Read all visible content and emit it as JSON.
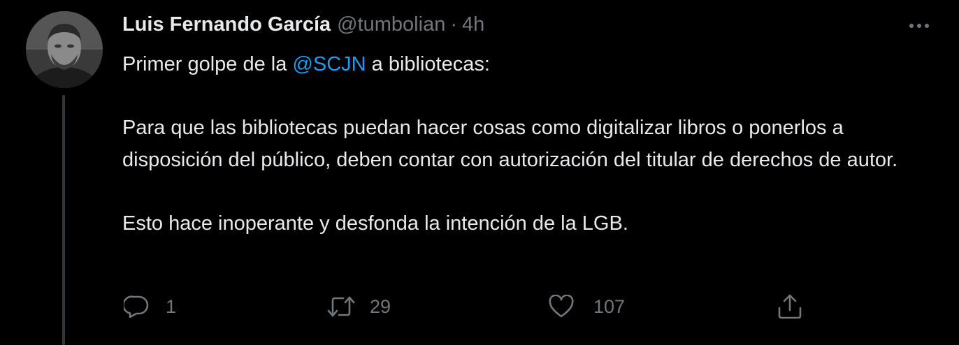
{
  "tweet": {
    "author": {
      "name": "Luis Fernando García",
      "handle": "@tumbolian",
      "separator": "·",
      "time": "4h",
      "avatar": "avatar-photo-grayscale"
    },
    "text": {
      "line1_prefix": "Primer golpe de la ",
      "line1_mention": "@SCJN",
      "line1_suffix": " a bibliotecas:",
      "paragraph2": "Para que las bibliotecas puedan hacer cosas como digitalizar libros o ponerlos a disposición del público, deben contar con autorización del titular de derechos de autor.",
      "paragraph3": "Esto hace inoperante y desfonda la intención de la LGB."
    },
    "actions": {
      "reply": {
        "icon": "reply-icon",
        "count": "1"
      },
      "retweet": {
        "icon": "retweet-icon",
        "count": "29"
      },
      "like": {
        "icon": "heart-icon",
        "count": "107"
      },
      "share": {
        "icon": "share-icon"
      }
    },
    "more_icon": "more-options-icon"
  },
  "colors": {
    "background": "#000000",
    "text_primary": "#e7e9ea",
    "text_secondary": "#71767b",
    "link": "#1d9bf0",
    "thread_line": "#333639"
  }
}
